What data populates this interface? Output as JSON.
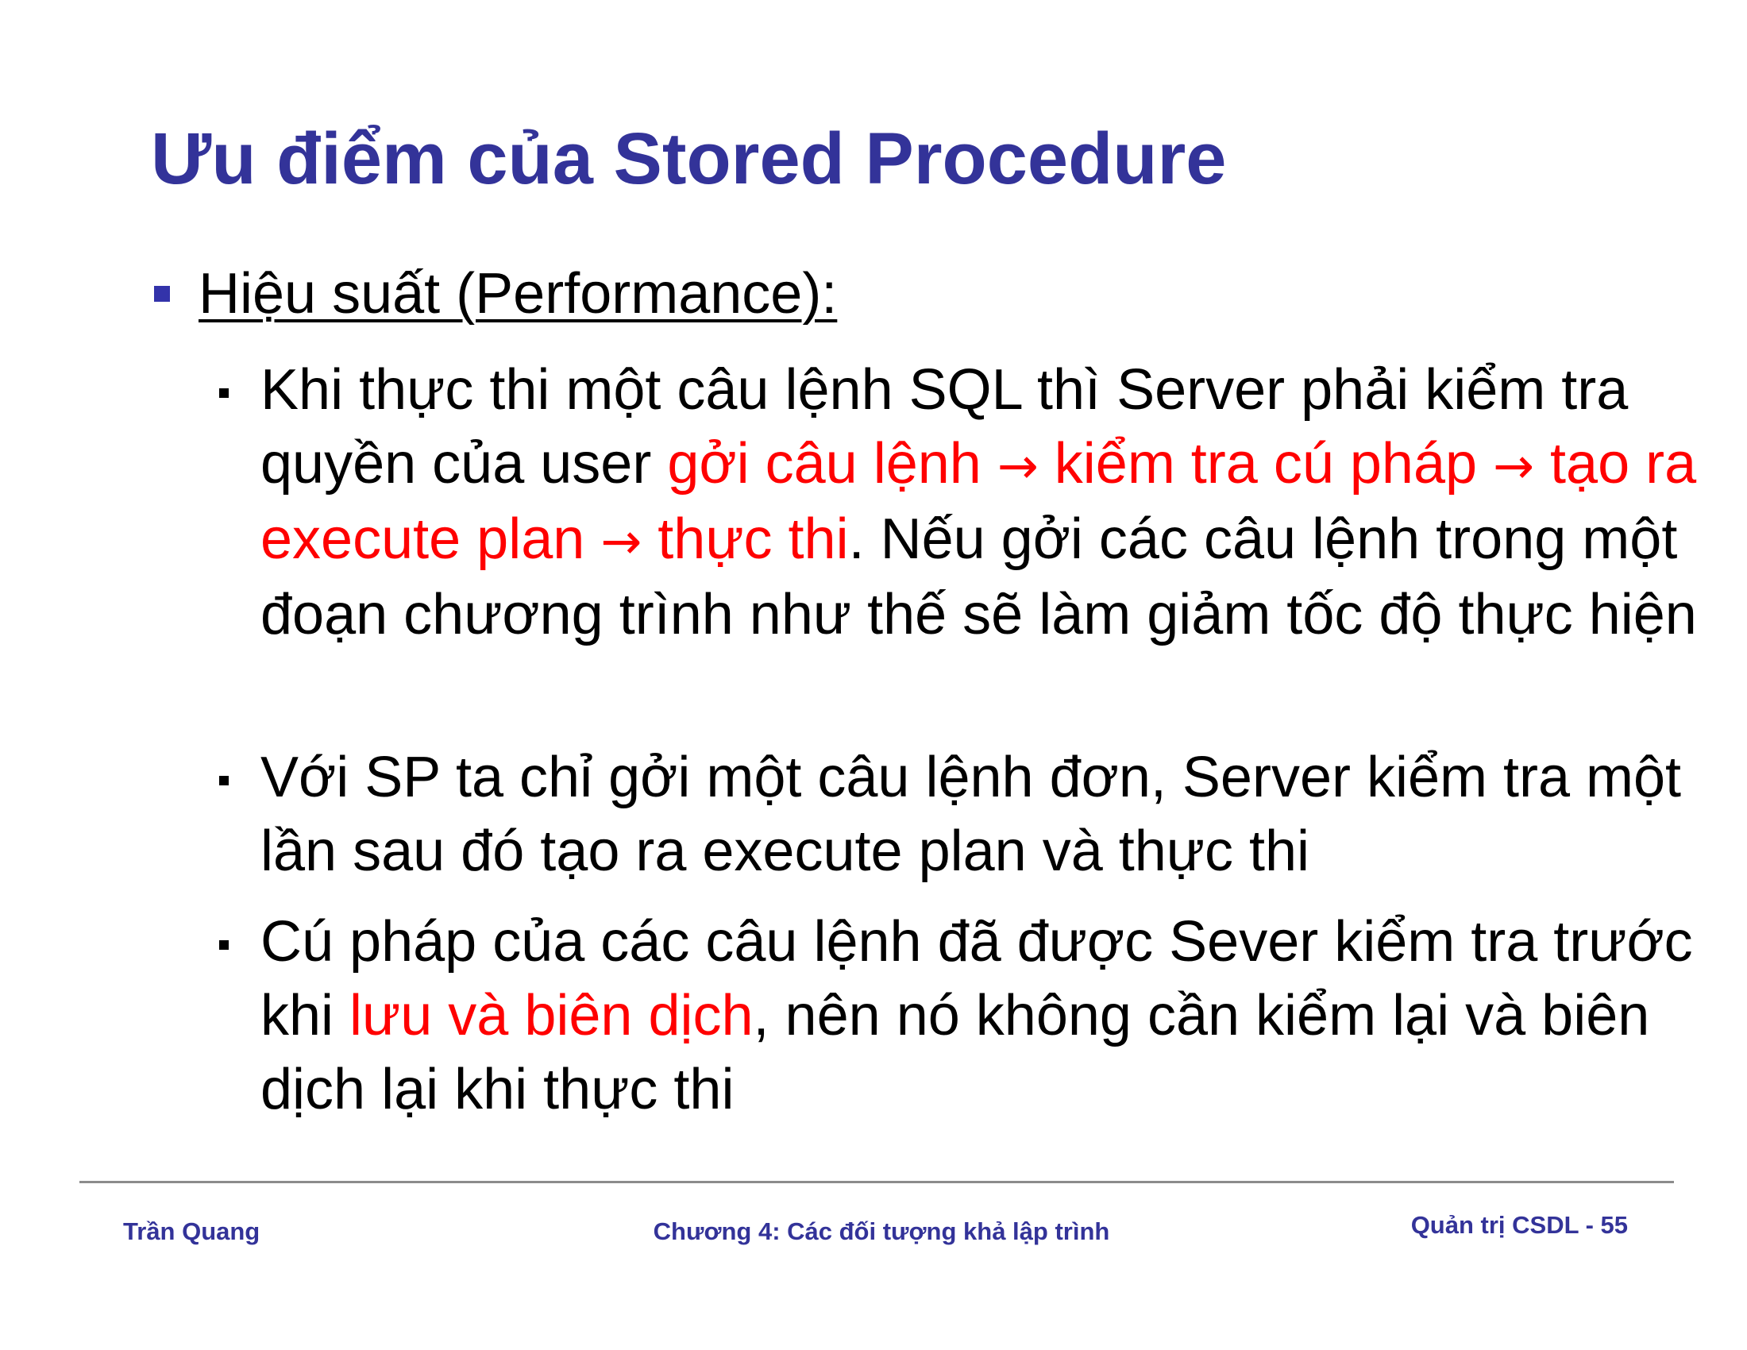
{
  "slide": {
    "title": "Ưu điểm của Stored Procedure",
    "section_heading": "Hiệu suất (Performance):",
    "points": [
      {
        "segments": [
          {
            "text": "Khi thực thi một câu lệnh SQL thì Server phải kiểm tra quyền của user ",
            "highlight": false
          },
          {
            "text": "gởi câu lệnh ",
            "highlight": true
          },
          {
            "text": "→",
            "highlight": true,
            "arrow": true
          },
          {
            "text": " kiểm tra cú pháp ",
            "highlight": true
          },
          {
            "text": "→",
            "highlight": true,
            "arrow": true
          },
          {
            "text": " tạo ra execute plan ",
            "highlight": true
          },
          {
            "text": "→",
            "highlight": true,
            "arrow": true
          },
          {
            "text": " thực thi",
            "highlight": true
          },
          {
            "text": ". Nếu gởi các câu lệnh trong một đoạn chương trình như thế sẽ làm giảm tốc độ thực hiện",
            "highlight": false
          }
        ]
      },
      {
        "segments": [
          {
            "text": "Với SP ta chỉ gởi một câu lệnh đơn, Server kiểm tra một lần sau đó tạo ra execute plan và thực thi",
            "highlight": false
          }
        ]
      },
      {
        "segments": [
          {
            "text": "Cú pháp của các câu lệnh đã được Sever kiểm tra trước khi ",
            "highlight": false
          },
          {
            "text": "lưu và biên dịch",
            "highlight": true
          },
          {
            "text": ", nên nó không cần kiểm lại và biên dịch lại khi thực thi",
            "highlight": false
          }
        ]
      }
    ]
  },
  "footer": {
    "author": "Trần Quang",
    "chapter": "Chương 4: Các đối tượng khả lập trình",
    "page_label": "Quản trị CSDL - 55"
  },
  "colors": {
    "title": "#333399",
    "highlight": "#ff0000",
    "footer": "#333399",
    "divider": "#8c8c8c"
  }
}
